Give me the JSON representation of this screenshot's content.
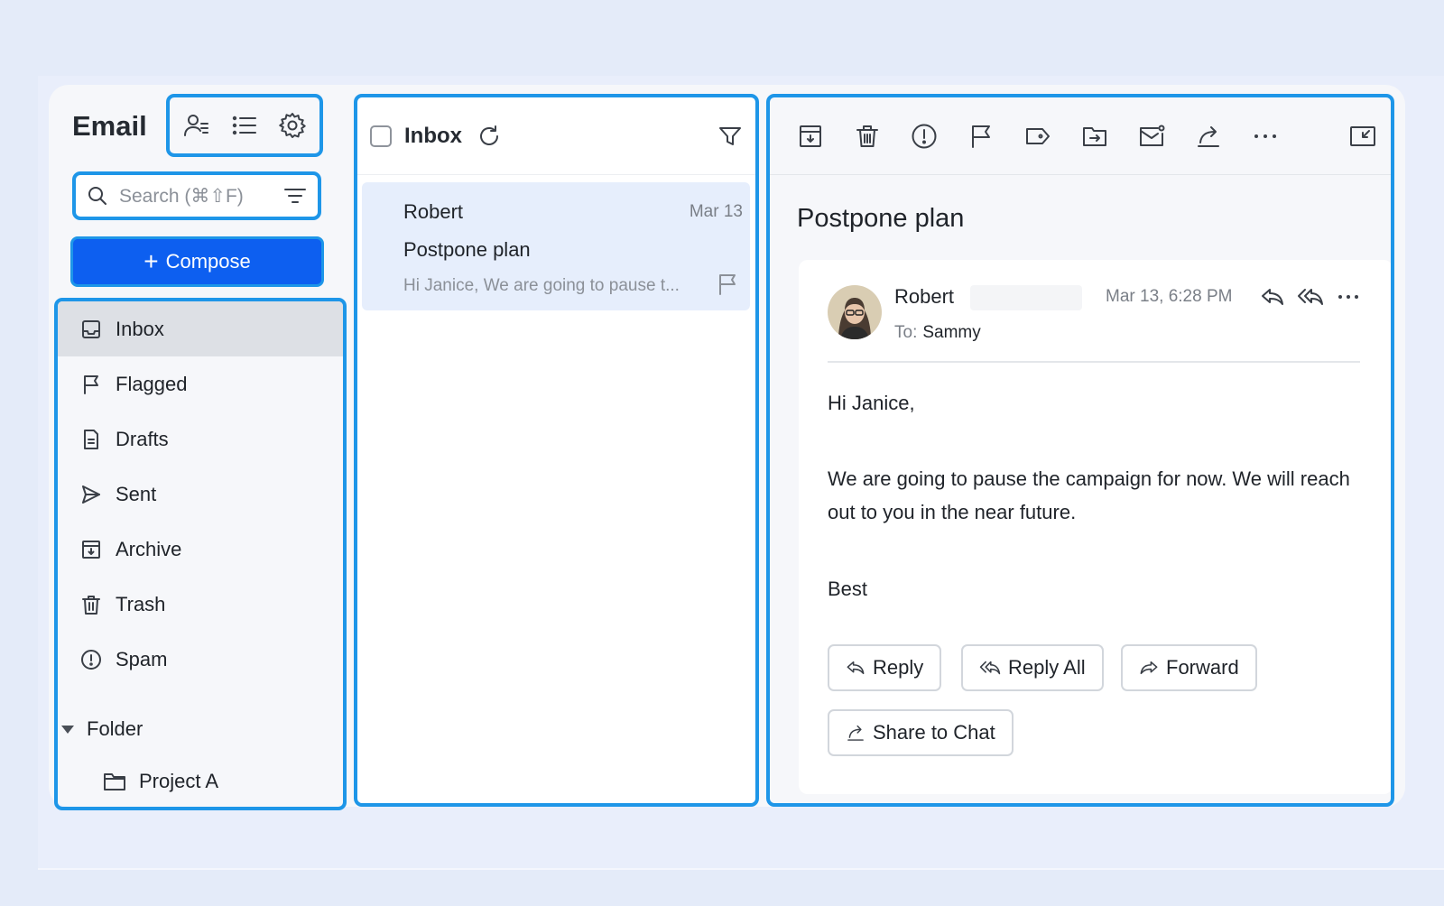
{
  "app": {
    "title": "Email"
  },
  "sidebar": {
    "header_icons": [
      "contacts-icon",
      "list-view-icon",
      "settings-gear-icon"
    ],
    "search": {
      "placeholder": "Search (⌘⇧F)"
    },
    "compose_label": "Compose",
    "items": [
      {
        "label": "Inbox",
        "icon": "inbox-icon",
        "active": true
      },
      {
        "label": "Flagged",
        "icon": "flag-icon"
      },
      {
        "label": "Drafts",
        "icon": "document-icon"
      },
      {
        "label": "Sent",
        "icon": "send-icon"
      },
      {
        "label": "Archive",
        "icon": "archive-icon"
      },
      {
        "label": "Trash",
        "icon": "trash-icon"
      },
      {
        "label": "Spam",
        "icon": "spam-icon"
      }
    ],
    "folder": {
      "label": "Folder",
      "items": [
        {
          "label": "Project A",
          "icon": "folder-icon"
        }
      ]
    }
  },
  "list": {
    "title": "Inbox",
    "messages": [
      {
        "sender": "Robert",
        "date": "Mar 13",
        "subject": "Postpone plan",
        "preview": "Hi Janice, We are going to pause t..."
      }
    ]
  },
  "reader": {
    "toolbar_icons": [
      "archive-icon",
      "trash-icon",
      "spam-icon",
      "flag-icon",
      "label-icon",
      "move-icon",
      "mark-unread-icon",
      "share-icon",
      "more-icon",
      "collapse-icon"
    ],
    "subject": "Postpone plan",
    "from": "Robert",
    "date": "Mar 13, 6:28 PM",
    "to_label": "To:",
    "to": "Sammy",
    "body": {
      "greeting": "Hi Janice,",
      "paragraph": "We are going to pause the campaign for now. We will reach out to you in the near future.",
      "signoff": "Best"
    },
    "buttons": {
      "reply": "Reply",
      "reply_all": "Reply All",
      "forward": "Forward",
      "share": "Share to Chat"
    }
  },
  "colors": {
    "accent": "#0d5ff0",
    "highlight": "#1e96e8",
    "selected_row": "#e6eefc",
    "page_bg": "#e4ebf9"
  }
}
